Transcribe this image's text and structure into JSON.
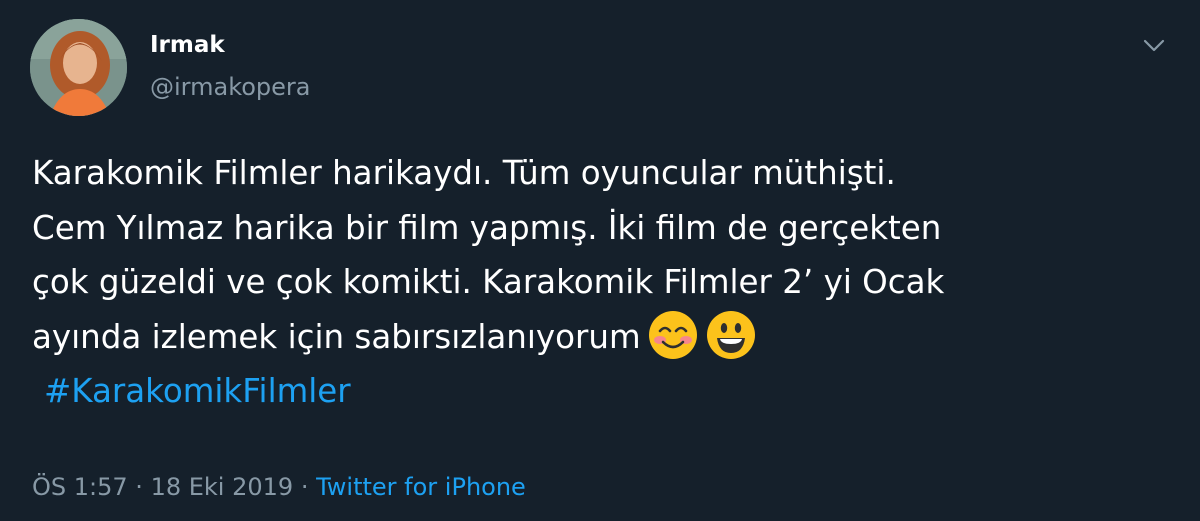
{
  "tweet": {
    "author": {
      "name": "Irmak",
      "handle": "@irmakopera"
    },
    "body_lines": [
      "Karakomik Filmler harikaydı. Tüm oyuncular müthişti.",
      "Cem Yılmaz harika bir film yapmış. İki film de gerçekten",
      "çok güzeldi ve çok komikti. Karakomik Filmler 2’ yi Ocak",
      "ayında izlemek için sabırsızlanıyorum"
    ],
    "emojis": [
      "smiling-face-with-smiling-eyes-icon",
      "grinning-face-icon"
    ],
    "hashtag": "#KarakomikFilmler",
    "time": "ÖS 1:57",
    "separator": "·",
    "date": "18 Eki 2019",
    "source": "Twitter for iPhone"
  },
  "colors": {
    "background": "#15202b",
    "text_primary": "#ffffff",
    "text_secondary": "#8899a6",
    "accent": "#1da1f2"
  }
}
